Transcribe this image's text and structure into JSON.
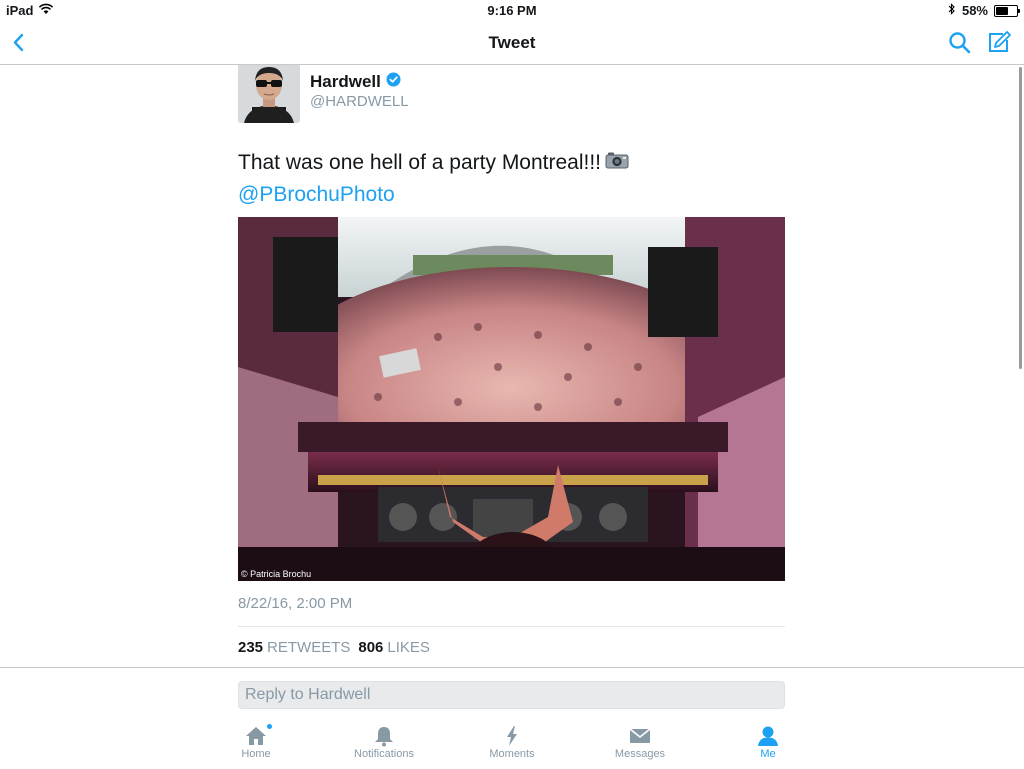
{
  "status_bar": {
    "device": "iPad",
    "time": "9:16 PM",
    "battery": "58%",
    "battery_level": 0.58
  },
  "nav": {
    "title": "Tweet",
    "icons": [
      "chevron-left-icon",
      "search-icon",
      "compose-icon"
    ]
  },
  "tweet": {
    "author_name": "Hardwell",
    "author_handle": "@HARDWELL",
    "verified": true,
    "text": "That was one hell of a party Montreal!!!",
    "mention": "@PBrochuPhoto",
    "photo_credit": "© Patricia Brochu",
    "timestamp": "8/22/16, 2:00 PM",
    "retweets_count": "235",
    "retweets_label": "RETWEETS",
    "likes_count": "806",
    "likes_label": "LIKES"
  },
  "reply": {
    "placeholder": "Reply to Hardwell"
  },
  "tabs": [
    {
      "label": "Home",
      "icon": "home-icon"
    },
    {
      "label": "Notifications",
      "icon": "bell-icon"
    },
    {
      "label": "Moments",
      "icon": "lightning-icon"
    },
    {
      "label": "Messages",
      "icon": "envelope-icon"
    },
    {
      "label": "Me",
      "icon": "person-icon",
      "active": true
    }
  ],
  "colors": {
    "accent": "#1da1f2",
    "muted": "#8899a6",
    "text": "#14171a"
  }
}
